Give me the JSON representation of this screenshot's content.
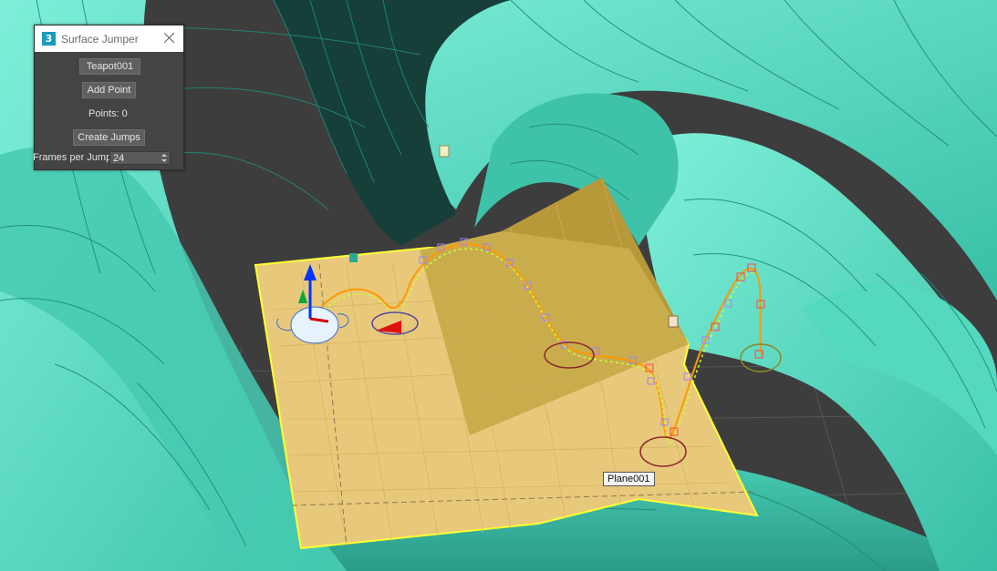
{
  "dialog": {
    "title": "Surface Jumper",
    "app_icon": "3",
    "object_button": "Teapot001",
    "add_point_button": "Add Point",
    "points_label": "Points: 0",
    "create_jumps_button": "Create Jumps",
    "frames_label": "Frames per Jump",
    "frames_value": "24"
  },
  "viewport": {
    "tooltip": "Plane001"
  },
  "colors": {
    "torus": "#5fe0c6",
    "torus_dark": "#1e6e62",
    "wire": "#1f8a7a",
    "plane": "#e6c67a",
    "plane_selected_edge": "#ffff33",
    "ramp": "#c9ad4c",
    "background": "#3f3f3f"
  }
}
